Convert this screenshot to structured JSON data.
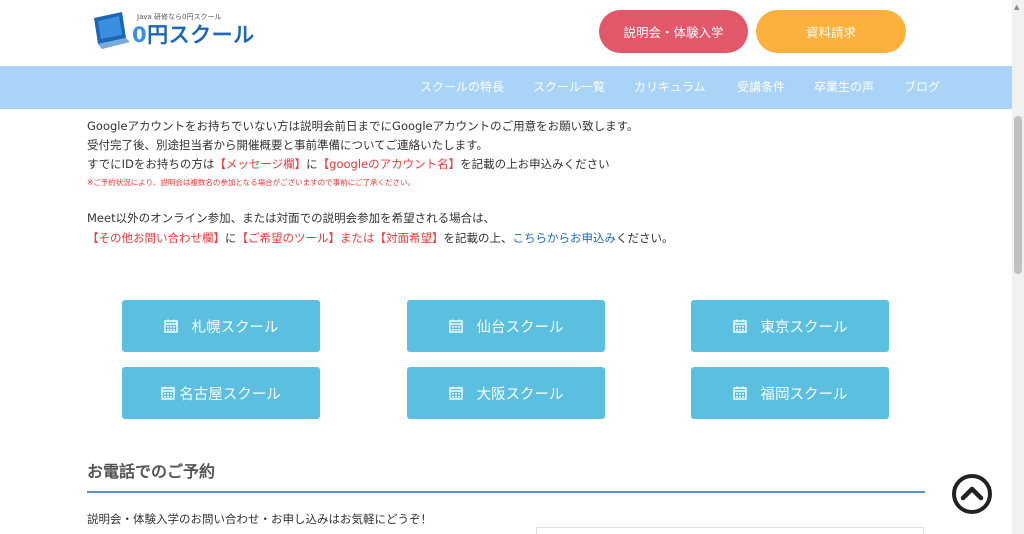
{
  "header": {
    "logo_tagline": "Java 研修なら0円スクール",
    "logo_zero": "0",
    "logo_name": "円スクール",
    "seminar_button": "説明会・体験入学",
    "docs_button": "資料請求"
  },
  "nav": {
    "items": [
      "スクールの特長",
      "スクール一覧",
      "カリキュラム",
      "受講条件",
      "卒業生の声",
      "ブログ"
    ]
  },
  "intro": {
    "line1": "Googleアカウントをお持ちでいない方は説明会前日までにGoogleアカウントのご用意をお願い致します。",
    "line2": "受付完了後、別途担当者から開催概要と事前準備についてご連絡いたします。",
    "line3_a": "すでにIDをお持ちの方は",
    "line3_red1": "【メッセージ欄】",
    "line3_b": "に",
    "line3_red2": "【googleのアカウント名】",
    "line3_c": "を記載の上お申込みください",
    "note": "※ご予約状況により、説明会は複数名の参加となる場合がございますので事前にご了承ください。",
    "line4": "Meet以外のオンライン参加、または対面での説明会参加を希望される場合は、",
    "line5_red1": "【その他お問い合わせ欄】",
    "line5_a": "に",
    "line5_red2": "【ご希望のツール】または【対面希望】",
    "line5_b": "を記載の上、",
    "line5_link": "こちらからお申込み",
    "line5_c": "ください。"
  },
  "schools": [
    "札幌スクール",
    "仙台スクール",
    "東京スクール",
    "名古屋スクール",
    "大阪スクール",
    "福岡スクール"
  ],
  "phone": {
    "title": "お電話でのご予約",
    "description": "説明会・体験入学のお問い合わせ・お申し込みはお気軽にどうぞ！"
  },
  "colors": {
    "nav_bg": "#a9d3f7",
    "seminar_button": "#e2586a",
    "docs_button": "#fbb13c",
    "school_button": "#5bbfdf",
    "accent_red": "#e83a3a"
  }
}
